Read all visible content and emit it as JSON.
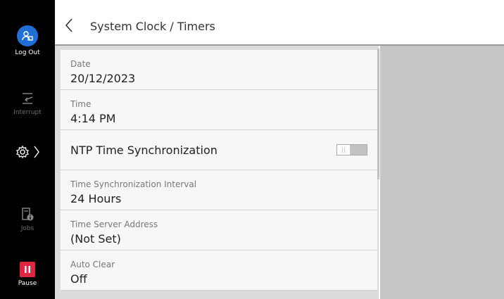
{
  "sidebar": {
    "logout_label": "Log Out",
    "interrupt_label": "Interrupt",
    "jobs_label": "Jobs",
    "pause_label": "Pause"
  },
  "header": {
    "title": "System Clock / Timers"
  },
  "settings": {
    "date": {
      "label": "Date",
      "value": "20/12/2023"
    },
    "time": {
      "label": "Time",
      "value": "4:14 PM"
    },
    "ntp": {
      "label": "NTP Time Synchronization",
      "enabled": false
    },
    "interval": {
      "label": "Time Synchronization Interval",
      "value": "24 Hours"
    },
    "server": {
      "label": "Time Server Address",
      "value": "(Not Set)"
    },
    "auto_clear": {
      "label": "Auto Clear",
      "value": "Off"
    }
  },
  "colors": {
    "accent": "#1f6fd6",
    "pause": "#e0263f"
  }
}
